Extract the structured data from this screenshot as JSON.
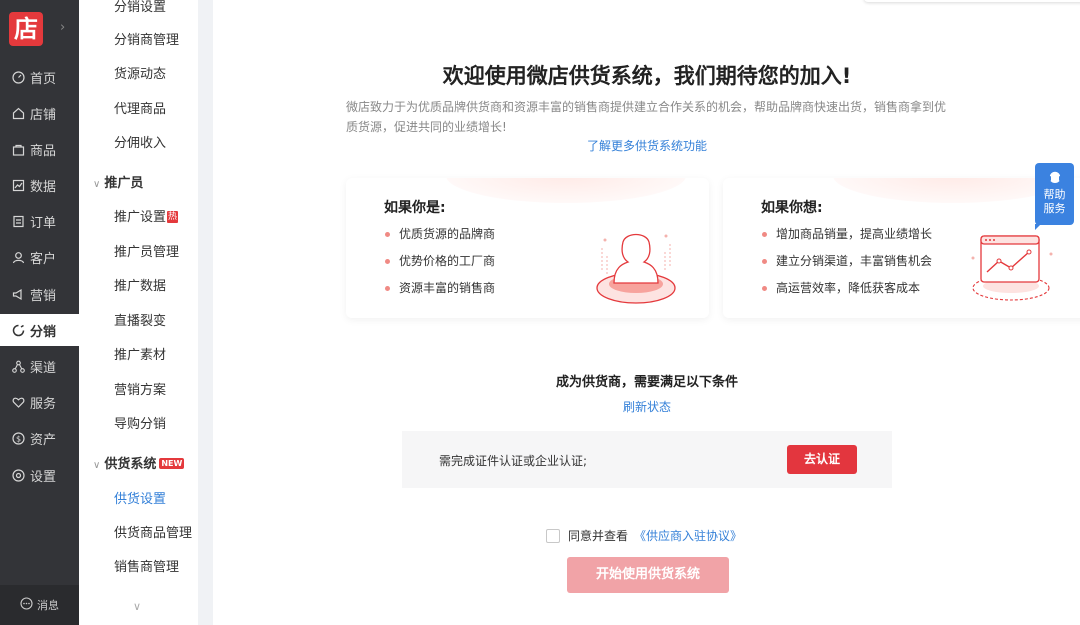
{
  "nav": {
    "logo_text": "店",
    "expand_icon": "chevron-right-icon",
    "items": [
      {
        "label": "首页",
        "icon": "home-dashboard-icon"
      },
      {
        "label": "店铺",
        "icon": "shop-icon"
      },
      {
        "label": "商品",
        "icon": "bag-icon"
      },
      {
        "label": "数据",
        "icon": "chart-icon"
      },
      {
        "label": "订单",
        "icon": "order-icon"
      },
      {
        "label": "客户",
        "icon": "user-icon"
      },
      {
        "label": "营销",
        "icon": "megaphone-icon"
      },
      {
        "label": "分销",
        "icon": "distribution-icon"
      },
      {
        "label": "渠道",
        "icon": "channel-icon"
      },
      {
        "label": "服务",
        "icon": "heart-icon"
      },
      {
        "label": "资产",
        "icon": "money-icon"
      },
      {
        "label": "设置",
        "icon": "settings-icon"
      }
    ],
    "active_index": 7,
    "message_label": "消息"
  },
  "submenu": {
    "top_items": [
      "分销设置",
      "分销商管理",
      "货源动态",
      "代理商品",
      "分佣收入"
    ],
    "group_promoter": {
      "label": "推广员",
      "items": [
        "推广设置",
        "推广员管理",
        "推广数据",
        "直播裂变",
        "推广素材",
        "营销方案",
        "导购分销"
      ],
      "hot_badge": "热"
    },
    "group_supply": {
      "label": "供货系统",
      "badge": "NEW",
      "items": [
        "供货设置",
        "供货商品管理",
        "销售商管理"
      ]
    },
    "more_icon": "chevron-down-icon"
  },
  "main": {
    "title": "欢迎使用微店供货系统，我们期待您的加入!",
    "intro": "微店致力于为优质品牌供货商和资源丰富的销售商提供建立合作关系的机会，帮助品牌商快速出货，销售商拿到优质货源，促进共同的业绩增长!",
    "learn_more": "了解更多供货系统功能",
    "card_left": {
      "title": "如果你是:",
      "items": [
        "优质货源的品牌商",
        "优势价格的工厂商",
        "资源丰富的销售商"
      ]
    },
    "card_right": {
      "title": "如果你想:",
      "items": [
        "增加商品销量，提高业绩增长",
        "建立分销渠道，丰富销售机会",
        "高运营效率，降低获客成本"
      ]
    },
    "conditions_title": "成为供货商，需要满足以下条件",
    "refresh_label": "刷新状态",
    "condition_text": "需完成证件认证或企业认证;",
    "certify_button": "去认证",
    "agree_text": "同意并查看",
    "agreement_link": "《供应商入驻协议》",
    "start_button": "开始使用供货系统"
  },
  "help": {
    "line1": "帮助",
    "line2": "服务"
  }
}
